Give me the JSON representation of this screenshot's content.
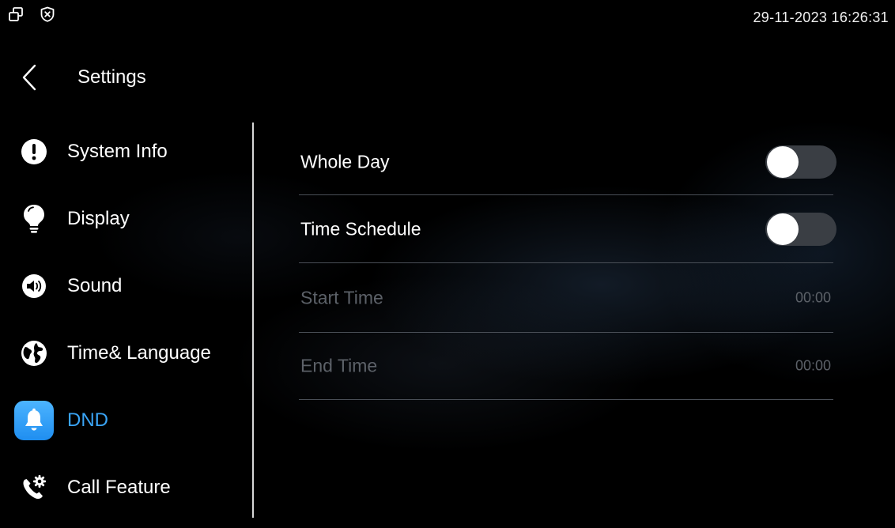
{
  "status_bar": {
    "icons": [
      "window-icon",
      "shield-x-icon"
    ],
    "datetime": "29-11-2023 16:26:31"
  },
  "header": {
    "back_icon": "chevron-left-icon",
    "title": "Settings"
  },
  "sidebar": {
    "items": [
      {
        "label": "System Info",
        "icon": "info-exclamation-icon",
        "active": false
      },
      {
        "label": "Display",
        "icon": "lightbulb-icon",
        "active": false
      },
      {
        "label": "Sound",
        "icon": "speaker-icon",
        "active": false
      },
      {
        "label": "Time& Language",
        "icon": "globe-icon",
        "active": false
      },
      {
        "label": "DND",
        "icon": "bell-icon",
        "active": true
      },
      {
        "label": "Call Feature",
        "icon": "phone-gear-icon",
        "active": false
      }
    ]
  },
  "dnd": {
    "whole_day": {
      "label": "Whole Day",
      "enabled": false
    },
    "time_schedule": {
      "label": "Time Schedule",
      "enabled": false
    },
    "start_time": {
      "label": "Start Time",
      "value": "00:00"
    },
    "end_time": {
      "label": "End Time",
      "value": "00:00"
    }
  },
  "colors": {
    "accent": "#3aa4f5",
    "disabled_text": "#5c6168",
    "toggle_off_track": "#3a3e44"
  }
}
